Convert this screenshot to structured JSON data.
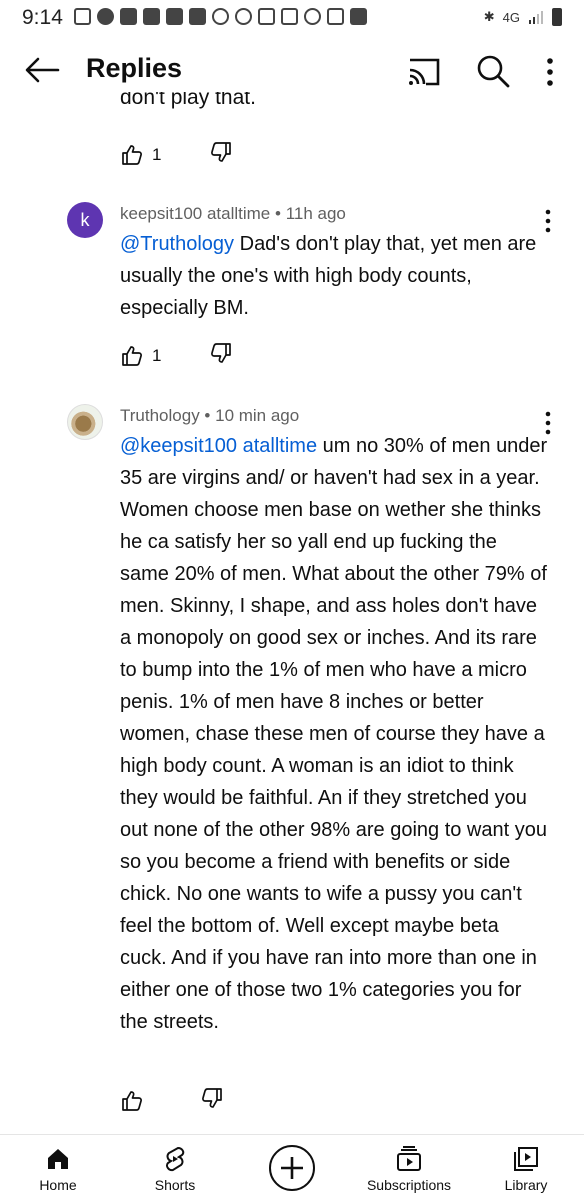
{
  "status_bar": {
    "time": "9:14",
    "network": "4G"
  },
  "header": {
    "title": "Replies"
  },
  "previous_reply": {
    "text_tail": "don't play that.",
    "likes": "1"
  },
  "comments": [
    {
      "avatar_letter": "k",
      "author": "keepsit100 atalltime",
      "time": "11h ago",
      "mention": "@Truthology",
      "text": " Dad's don't play that, yet men are usually the one's with high body counts, especially BM.",
      "likes": "1"
    },
    {
      "author": "Truthology",
      "time": "10 min ago",
      "mention": "@keepsit100 atalltime",
      "text": " um no 30% of men under 35 are virgins and/ or haven't had sex in a year. Women choose men base on wether she thinks he ca satisfy her so yall end up fucking the same 20% of men. What about the  other 79% of men. Skinny, I shape, and ass holes don't have a monopoly on good sex or inches. And its rare to bump into the 1% of men who have a micro penis. 1% of men have 8 inches or better women, chase these men of course they have a high body count. A woman is an idiot to think they would be faithful. An if they stretched you out none of the other 98% are going to want you so you become a friend with benefits or side chick. No one wants to wife a pussy you can't feel the bottom of. Well except maybe beta cuck. And if you have ran into more than one in either one  of those two 1% categories you for the streets.",
      "likes": ""
    }
  ],
  "bottom_nav": {
    "home": "Home",
    "shorts": "Shorts",
    "subscriptions": "Subscriptions",
    "library": "Library"
  },
  "colors": {
    "mention": "#065fd4",
    "avatar_k": "#5e35b1",
    "meta_text": "#606060"
  }
}
